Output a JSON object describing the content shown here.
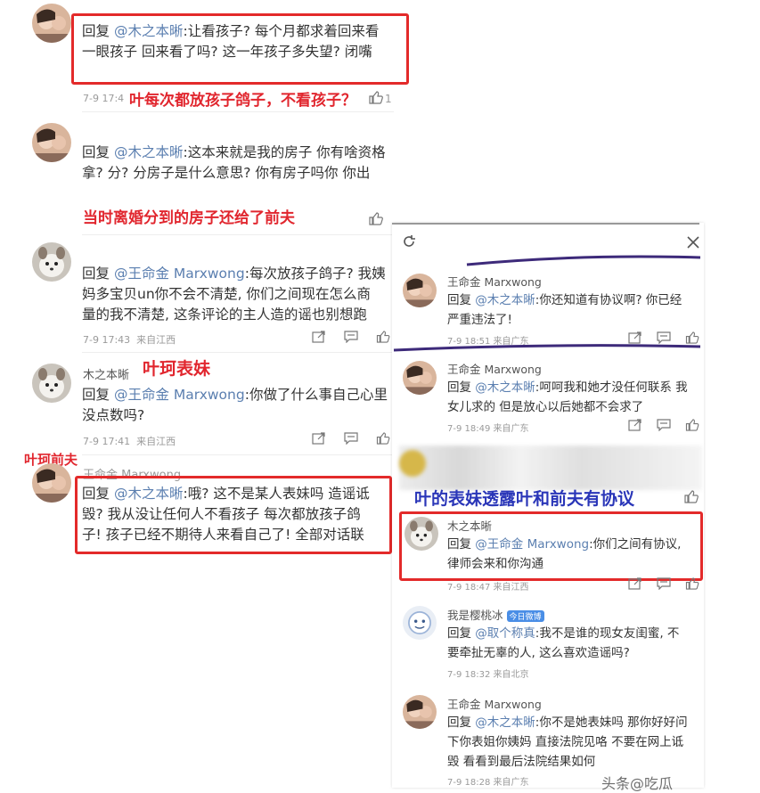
{
  "left": {
    "c1": {
      "reply_prefix": "回复",
      "mention": "@木之本晰",
      "text_l1": ":让看孩子? 每个月都求着回来看",
      "text_l2": "一眼孩子 回来看了吗? 这一年孩子多失望? 闭嘴",
      "time": "7-9 17:4",
      "likes": "1"
    },
    "anno1": "叶每次都放孩子鸽子，不看孩子？",
    "c2": {
      "reply_prefix": "回复",
      "mention": "@木之本晰",
      "text_l1": ":这本来就是我的房子 你有啥资格",
      "text_l2": "拿? 分? 分房子是什么意思? 你有房子吗你 你出"
    },
    "anno2": "当时离婚分到的房子还给了前夫",
    "c3": {
      "reply_prefix": "回复",
      "mention": "@王命金 Marxwong",
      "text_l1": ":每次放孩子鸽子? 我姨",
      "text_l2": "妈多宝贝un你不会不清楚, 你们之间现在怎么商",
      "text_l3": "量的我不清楚, 这条评论的主人造的谣也别想跑",
      "time": "7-9 17:43",
      "source": "来自江西"
    },
    "c4": {
      "uname": "木之本晰",
      "reply_prefix": "回复",
      "mention": "@王命金 Marxwong",
      "text_l1": ":你做了什么事自己心里",
      "text_l2": "没点数吗?",
      "time": "7-9 17:41",
      "source": "来自江西"
    },
    "anno3": "叶珂表妹",
    "anno4": "叶珂前夫",
    "c5": {
      "uname": "王命金 Marxwong",
      "reply_prefix": "回复",
      "mention": "@木之本晰",
      "text_l1": ":哦? 这不是某人表妹吗 造谣诋",
      "text_l2": "毁? 我从没让任何人不看孩子 每次都放孩子鸽",
      "text_l3": "子! 孩子已经不期待人来看自己了! 全部对话联"
    }
  },
  "right": {
    "refresh_icon": "refresh-icon",
    "close_icon": "close-icon",
    "r1": {
      "uname": "王命金 Marxwong",
      "reply_prefix": "回复",
      "mention": "@木之本晰",
      "text_l1": ":你还知道有协议啊? 你已经",
      "text_l2": "严重违法了!",
      "time": "7-9 18:51",
      "source": "来自广东"
    },
    "r2": {
      "uname": "王命金 Marxwong",
      "reply_prefix": "回复",
      "mention": "@木之本晰",
      "text_l1": ":呵呵我和她才没任何联系 我",
      "text_l2": "女儿求的 但是放心以后她都不会求了",
      "time": "7-9 18:49",
      "source": "来自广东"
    },
    "anno5": "叶的表妹透露叶和前夫有协议",
    "r3": {
      "uname": "木之本晰",
      "reply_prefix": "回复",
      "mention": "@王命金 Marxwong",
      "text_l1": ":你们之间有协议,",
      "text_l2": "律师会来和你沟通",
      "time": "7-9 18:47",
      "source": "来自江西"
    },
    "r4": {
      "uname": "我是樱桃冰",
      "badge": "今日微博",
      "reply_prefix": "回复",
      "mention": "@取个称真",
      "text_l1": ":我不是谁的现女友闺蜜, 不",
      "text_l2": "要牵扯无辜的人, 这么喜欢造谣吗?",
      "time": "7-9 18:32",
      "source": "来自北京"
    },
    "r5": {
      "uname": "王命金 Marxwong",
      "reply_prefix": "回复",
      "mention": "@木之本晰",
      "text_l1": ":你不是她表妹吗 那你好好问",
      "text_l2": "下你表姐你姨妈 直接法院见咯 不要在网上诋",
      "text_l3": "毁 看看到最后法院结果如何",
      "time": "7-9 18:28",
      "source": "来自广东"
    },
    "watermark": "头条@吃瓜"
  }
}
